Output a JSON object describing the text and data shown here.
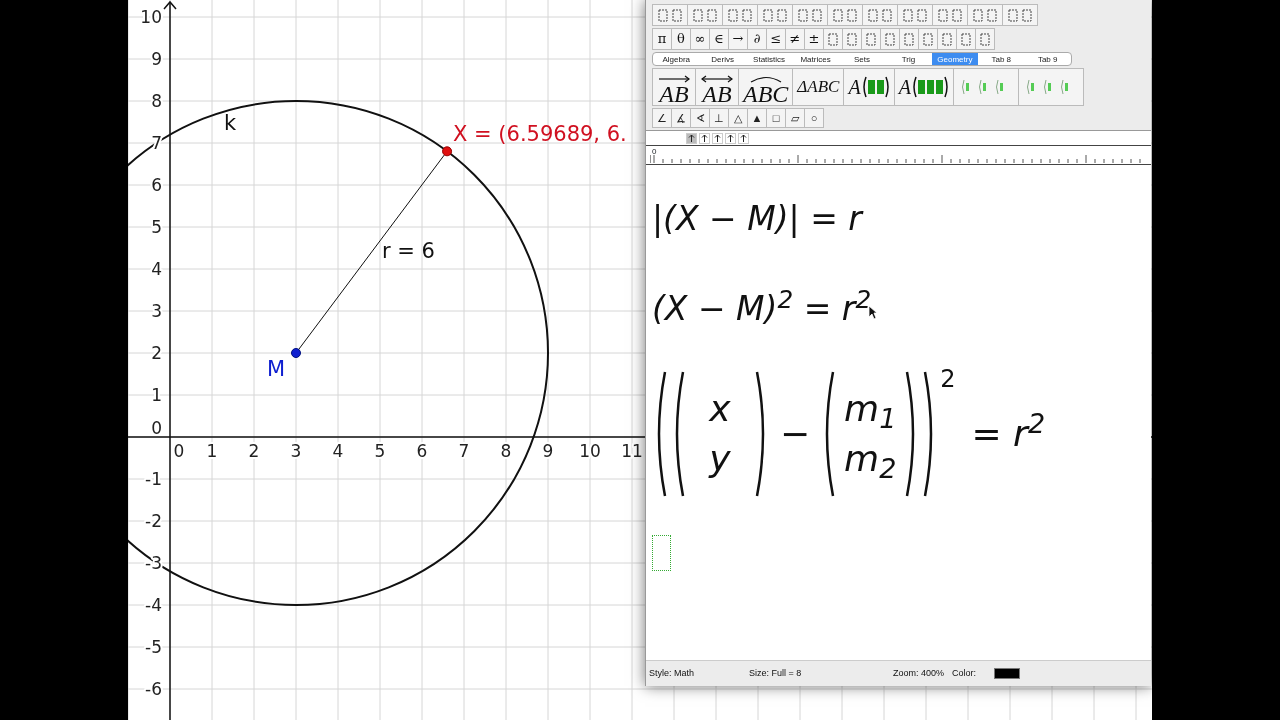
{
  "graphics": {
    "x_labels": [
      "0",
      "1",
      "2",
      "3",
      "4",
      "5",
      "6",
      "7",
      "8",
      "9",
      "10",
      "11"
    ],
    "y_labels": [
      "10",
      "9",
      "8",
      "7",
      "6",
      "5",
      "4",
      "3",
      "2",
      "1",
      "0",
      "-1",
      "-2",
      "-3",
      "-4",
      "-5",
      "-6"
    ],
    "circle_label": "k",
    "point_m_label": "M",
    "point_x_label": "X = (6.59689, 6.",
    "segment_label": "r = 6"
  },
  "editor": {
    "symbols": [
      "π",
      "θ",
      "∞",
      "∈",
      "→",
      "∂",
      "≤",
      "≠",
      "±"
    ],
    "tabs": [
      {
        "label": "Algebra",
        "selected": false
      },
      {
        "label": "Derivs",
        "selected": false
      },
      {
        "label": "Statistics",
        "selected": false
      },
      {
        "label": "Matrices",
        "selected": false
      },
      {
        "label": "Sets",
        "selected": false
      },
      {
        "label": "Trig",
        "selected": false
      },
      {
        "label": "Geometry",
        "selected": true
      },
      {
        "label": "Tab 8",
        "selected": false
      },
      {
        "label": "Tab 9",
        "selected": false
      }
    ],
    "geometry_templates": [
      {
        "kind": "over-arrow",
        "label": "AB"
      },
      {
        "kind": "over-double-arrow",
        "label": "AB"
      },
      {
        "kind": "arc",
        "label": "ABC"
      },
      {
        "kind": "plain",
        "label": "ΔABC"
      },
      {
        "kind": "paren-two",
        "label": "A"
      },
      {
        "kind": "paren-three",
        "label": "A"
      },
      {
        "kind": "faded"
      },
      {
        "kind": "faded"
      }
    ],
    "geometry_symbols": [
      "∠",
      "∡",
      "∢",
      "⊥",
      "△",
      "▲",
      "□",
      "▱",
      "○"
    ],
    "tab_stops": [
      {
        "selected": true
      },
      {
        "selected": false
      },
      {
        "selected": false
      },
      {
        "selected": false
      },
      {
        "selected": false
      }
    ],
    "ruler_origin": "0",
    "equations": [
      {
        "kind": "line",
        "text": "|(X − M)| = r"
      },
      {
        "kind": "line",
        "text": "(X − M)$^{2}$ = r$^{2}$"
      },
      {
        "kind": "vector",
        "left": [
          "x",
          "y"
        ],
        "operator": "−",
        "right": [
          "m$_{1}$",
          "m$_{2}$"
        ],
        "exponent": "2",
        "rhs": "= r$^{2}$"
      }
    ],
    "status_bar": {
      "style": "Style: Math",
      "size": "Size: Full = 8",
      "zoom": "Zoom: 400%",
      "color_label": "Color:",
      "color": "#000000"
    }
  }
}
